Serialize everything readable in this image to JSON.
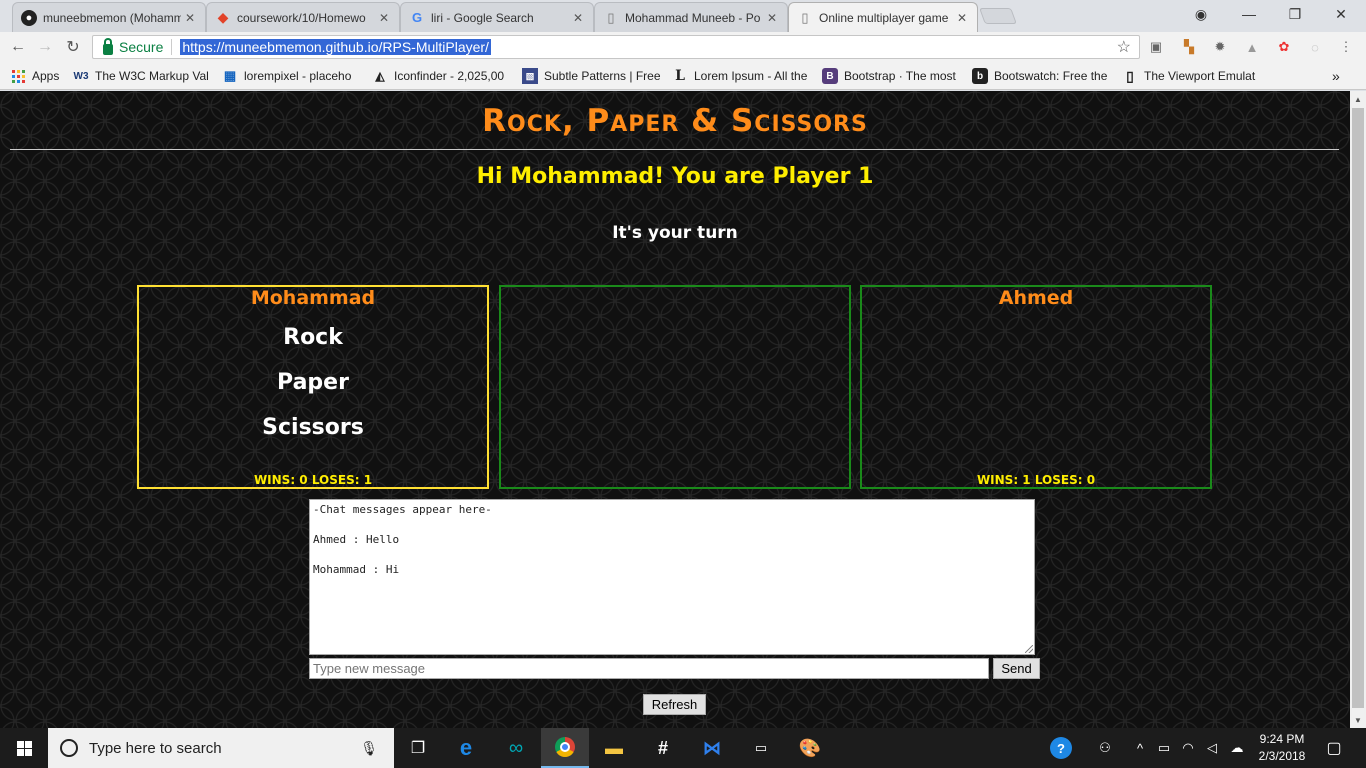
{
  "browser": {
    "tabs": [
      {
        "label": "muneebmemon (Mohamm",
        "icon": "github-icon"
      },
      {
        "label": "coursework/10/Homewo",
        "icon": "gitlab-icon"
      },
      {
        "label": "liri - Google Search",
        "icon": "google-icon"
      },
      {
        "label": "Mohammad Muneeb - Po",
        "icon": "page-icon"
      },
      {
        "label": "Online multiplayer game",
        "icon": "page-icon",
        "active": true
      }
    ],
    "secure_label": "Secure",
    "url": "https://muneebmemon.github.io/RPS-MultiPlayer/",
    "bookmarks": [
      {
        "label": "Apps"
      },
      {
        "label": "The W3C Markup Val"
      },
      {
        "label": "lorempixel - placeho"
      },
      {
        "label": "Iconfinder - 2,025,00"
      },
      {
        "label": "Subtle Patterns | Free"
      },
      {
        "label": "Lorem Ipsum - All the"
      },
      {
        "label": "Bootstrap · The most"
      },
      {
        "label": "Bootswatch: Free the"
      },
      {
        "label": "The Viewport Emulat"
      }
    ],
    "bookmarks_overflow": "»"
  },
  "game": {
    "title": "Rock, Paper & Scissors",
    "greeting": "Hi Mohammad! You are Player 1",
    "status": "It's your turn",
    "player1": {
      "name": "Mohammad",
      "choices": [
        "Rock",
        "Paper",
        "Scissors"
      ],
      "score": "WINS: 0 LOSES: 1"
    },
    "player2": {
      "name": "Ahmed",
      "score": "WINS: 1 LOSES: 0"
    },
    "chat": {
      "messages": [
        "-Chat messages appear here-",
        "Ahmed : Hello",
        "Mohammad : Hi"
      ],
      "placeholder": "Type new message",
      "send_label": "Send"
    },
    "refresh_label": "Refresh"
  },
  "taskbar": {
    "search_placeholder": "Type here to search",
    "time": "9:24 PM",
    "date": "2/3/2018"
  },
  "colors": {
    "title": "#ff8c1a",
    "greeting": "#ffee00",
    "active_border": "#ffe033",
    "inactive_border": "#1a8a1a",
    "page_bg": "#101010"
  }
}
